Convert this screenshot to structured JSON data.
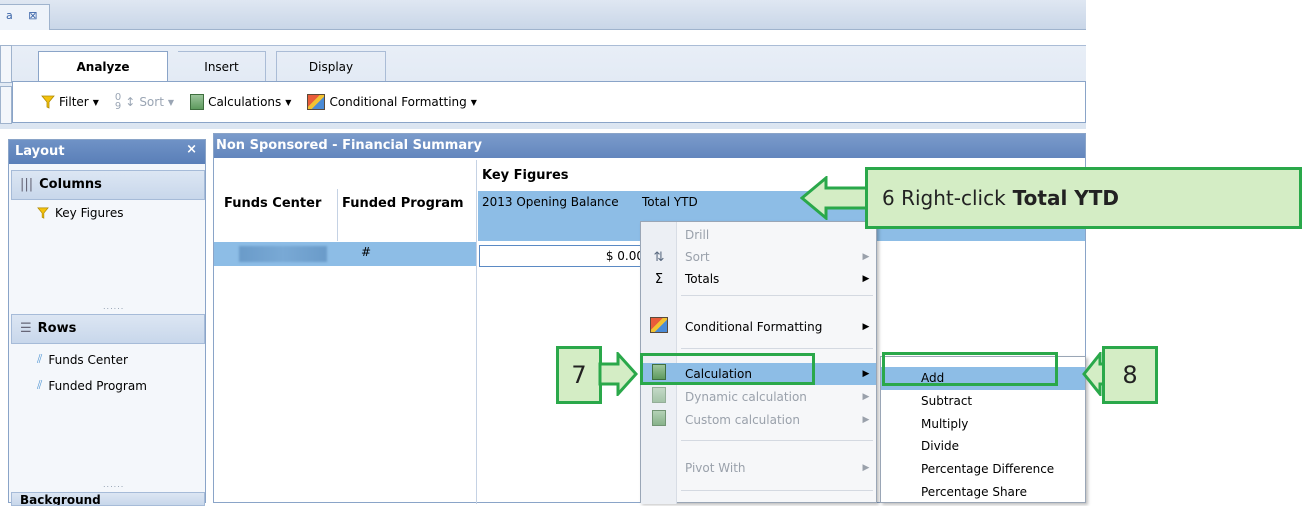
{
  "doc_tab": {
    "label": "a",
    "close": "⊠"
  },
  "ribbon": {
    "tabs": [
      {
        "label": "Analyze"
      },
      {
        "label": "Insert"
      },
      {
        "label": "Display"
      }
    ],
    "toolbar": {
      "filter": "Filter",
      "sort": "Sort",
      "calculations": "Calculations",
      "conditional_formatting": "Conditional Formatting"
    }
  },
  "layout_panel": {
    "title": "Layout",
    "close": "×",
    "columns": {
      "title": "Columns",
      "items": [
        "Key Figures"
      ]
    },
    "rows": {
      "title": "Rows",
      "items": [
        "Funds Center",
        "Funded Program"
      ]
    },
    "bookmarks": "Background",
    "grip": "......"
  },
  "report": {
    "title": "Non Sponsored - Financial Summary",
    "key_figures": "Key Figures",
    "col_funds_center": "Funds Center",
    "col_funded_program": "Funded Program",
    "hdr_opening": "2013 Opening Balance",
    "hdr_total": "Total YTD",
    "row_hash": "#",
    "cell_value": "$ 0.00"
  },
  "context_menu": {
    "items": [
      {
        "label": "Drill",
        "disabled": true
      },
      {
        "label": "Sort",
        "disabled": true
      },
      {
        "label": "Totals",
        "disabled": false
      },
      {
        "label": "Conditional Formatting",
        "disabled": false
      },
      {
        "label": "Calculation",
        "disabled": false
      },
      {
        "label": "Dynamic calculation",
        "disabled": true
      },
      {
        "label": "Custom calculation",
        "disabled": true
      },
      {
        "label": "Pivot With",
        "disabled": true
      }
    ]
  },
  "submenu": {
    "items": [
      "Add",
      "Subtract",
      "Multiply",
      "Divide",
      "Percentage Difference",
      "Percentage Share"
    ]
  },
  "callouts": {
    "step6_prefix": "6 Right-click",
    "step6_bold": "Total YTD",
    "step7": "7",
    "step8": "8"
  },
  "colors": {
    "accent_green": "#2aa84a",
    "callout_fill": "#d4edc5",
    "selection_blue": "#8dbde6",
    "header_blue": "#6386bd"
  }
}
